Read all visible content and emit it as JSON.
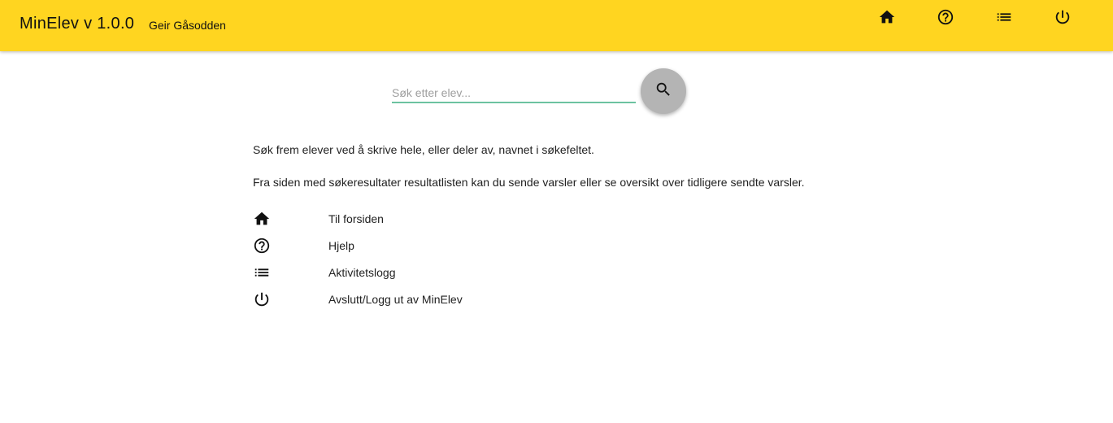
{
  "header": {
    "title": "MinElev v 1.0.0",
    "user": "Geir Gåsodden",
    "accent_color": "#ffd520",
    "nav": [
      {
        "icon": "home-icon"
      },
      {
        "icon": "help-icon"
      },
      {
        "icon": "list-icon"
      },
      {
        "icon": "power-icon"
      }
    ]
  },
  "search": {
    "placeholder": "Søk etter elev...",
    "value": "",
    "button_icon": "search-icon",
    "underline_color": "#6cc3a1"
  },
  "info": {
    "line1": "Søk frem elever ved å skrive hele, eller deler av, navnet i søkefeltet.",
    "line2": "Fra siden med søkeresultater resultatlisten kan du sende varsler eller se oversikt over tidligere sendte varsler."
  },
  "menu": [
    {
      "icon": "home-icon",
      "label": "Til forsiden"
    },
    {
      "icon": "help-icon",
      "label": "Hjelp"
    },
    {
      "icon": "list-icon",
      "label": "Aktivitetslogg"
    },
    {
      "icon": "power-icon",
      "label": "Avslutt/Logg ut av MinElev"
    }
  ]
}
